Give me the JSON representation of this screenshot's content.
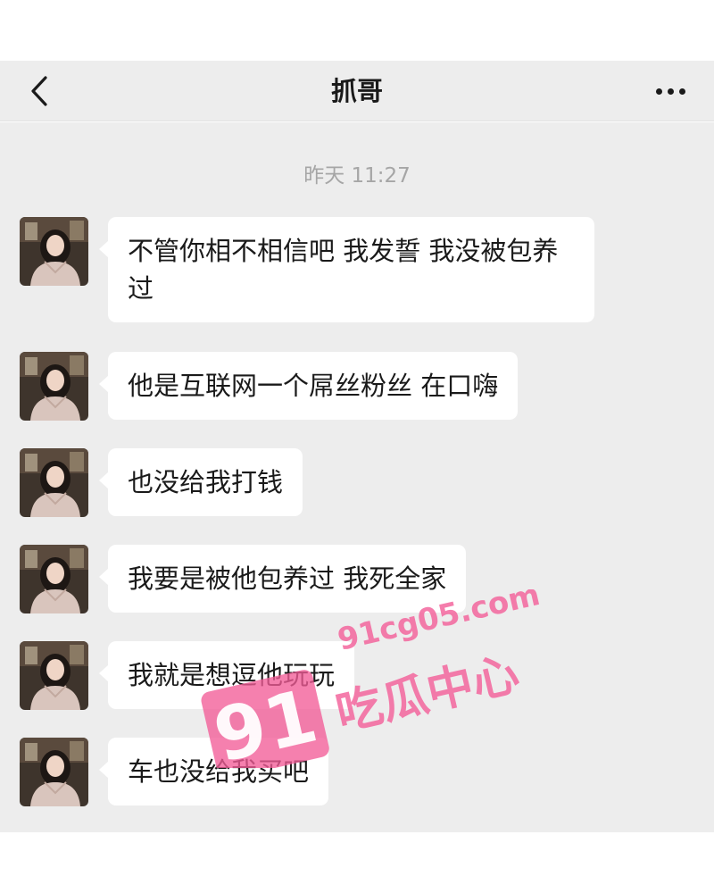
{
  "header": {
    "title": "抓哥",
    "back_icon": "chevron-left-icon",
    "more_icon": "more-horizontal-icon"
  },
  "chat": {
    "timestamp": "昨天 11:27",
    "messages": [
      {
        "text": "不管你相不相信吧 我发誓 我没被包养过"
      },
      {
        "text": "他是互联网一个屌丝粉丝 在口嗨"
      },
      {
        "text": "也没给我打钱"
      },
      {
        "text": "我要是被他包养过 我死全家"
      },
      {
        "text": "我就是想逗他玩玩"
      },
      {
        "text": "车也没给我买吧"
      }
    ]
  },
  "watermark": {
    "site": "91cg05.com",
    "number": "91",
    "name": "吃瓜中心",
    "color": "#f25c97"
  },
  "colors": {
    "chat_background": "#ededed",
    "bubble": "#ffffff",
    "text": "#1a1a1a",
    "timestamp": "#a6a6a6"
  }
}
